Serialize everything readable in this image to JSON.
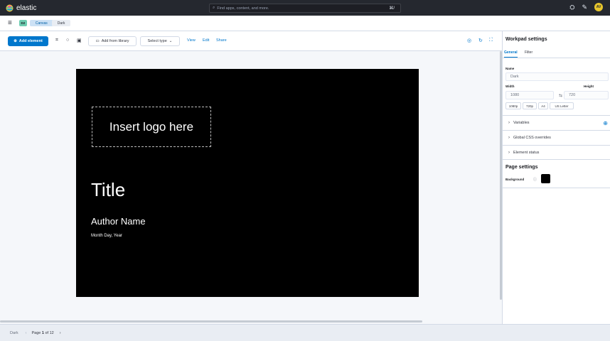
{
  "header": {
    "brand": "elastic",
    "search_placeholder": "Find apps, content, and more.",
    "search_shortcut": "⌘/",
    "avatar_initials": "AV"
  },
  "breadcrumbs": {
    "space_initials": "D2",
    "items": [
      "Canvas",
      "Dark"
    ]
  },
  "toolbar": {
    "add_element": "Add element",
    "add_from_library": "Add from library",
    "select_type": "Select type",
    "links": [
      "View",
      "Edit",
      "Share"
    ]
  },
  "slide": {
    "logo_placeholder": "Insert logo here",
    "title": "Title",
    "author": "Author Name",
    "date": "Month Day, Year",
    "background": "#000000"
  },
  "settings": {
    "title": "Workpad settings",
    "tabs": [
      "General",
      "Filter"
    ],
    "active_tab": "General",
    "name_label": "Name",
    "name_value": "Dark",
    "width_label": "Width",
    "width_value": "1080",
    "height_label": "Height",
    "height_value": "720",
    "swap_symbol": "⇆",
    "presets": [
      "1080p",
      "720p",
      "A4",
      "US Letter"
    ],
    "sections": [
      "Variables",
      "Global CSS overrides",
      "Element status"
    ],
    "page_settings_title": "Page settings",
    "background_label": "Background"
  },
  "pagebar": {
    "workpad_name": "Dark",
    "page_text": "Page",
    "page_current": "1",
    "page_of": "of 12"
  },
  "colors": {
    "accent": "#0077cc",
    "header_bg": "#25282f",
    "space_badge": "#6dccb1",
    "avatar": "#e7c62d"
  }
}
